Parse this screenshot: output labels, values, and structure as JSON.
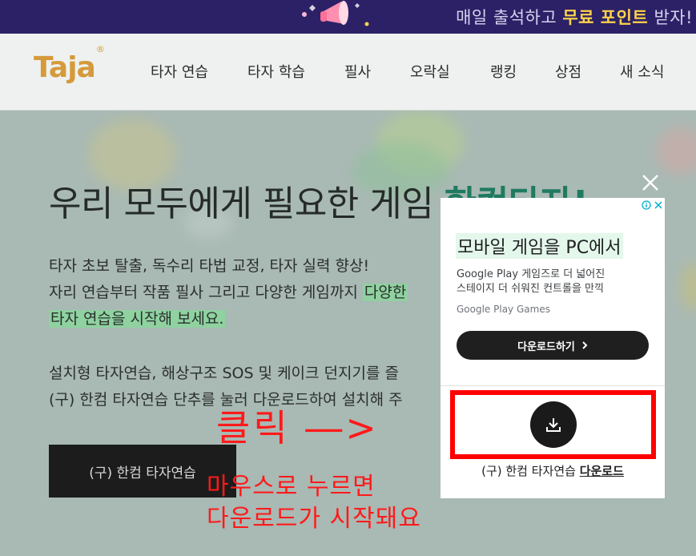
{
  "promo": {
    "text_prefix": "매일 출석하고 ",
    "text_highlight": "무료 포인트",
    "text_suffix": " 받자!"
  },
  "nav": {
    "logo": "Taja",
    "logo_mark": "®",
    "items": [
      "타자 연습",
      "타자 학습",
      "필사",
      "오락실",
      "랭킹",
      "상점",
      "새 소식"
    ]
  },
  "hero": {
    "title_prefix": "우리 모두에게 필요한 게임 ",
    "title_accent": "한컴타자!",
    "line1": "타자 초보 탈출, 독수리 타법 교정, 타자 실력 향상!",
    "line2_prefix": "자리 연습부터 작품 필사 그리고 다양한 게임까지 ",
    "line2_mark": "다양한",
    "line3": "타자 연습을 시작해 보세요.",
    "line4": "설치형 타자연습, 해상구조 SOS 및 케이크 던지기를 즐",
    "line5": "(구) 한컴 타자연습 단추를 눌러 다운로드하여 설치해 주",
    "button": "(구) 한컴 타자연습"
  },
  "annotation": {
    "click": "클릭 ―>",
    "sub1": "마우스로 누르면",
    "sub2": "다운로드가 시작돼요",
    "color": "#ff1a1a"
  },
  "ad": {
    "headline": "모바일 게임을 PC에서",
    "body1": "Google Play 게임즈로 더 넓어진",
    "body2": "스테이지 더 쉬워진 컨트롤을 만끽",
    "source": "Google Play Games",
    "cta": "다운로드하기",
    "info_icon": "info-icon",
    "close_icon": "close-icon"
  },
  "download": {
    "caption_prefix": "(구) 한컴 타자연습 ",
    "caption_link": "다운로드",
    "icon": "download-icon"
  },
  "colors": {
    "promo_bg": "#2c2166",
    "accent_green": "#1f7a60",
    "logo": "#d59a3b",
    "highlight_box": "#ff0000"
  }
}
